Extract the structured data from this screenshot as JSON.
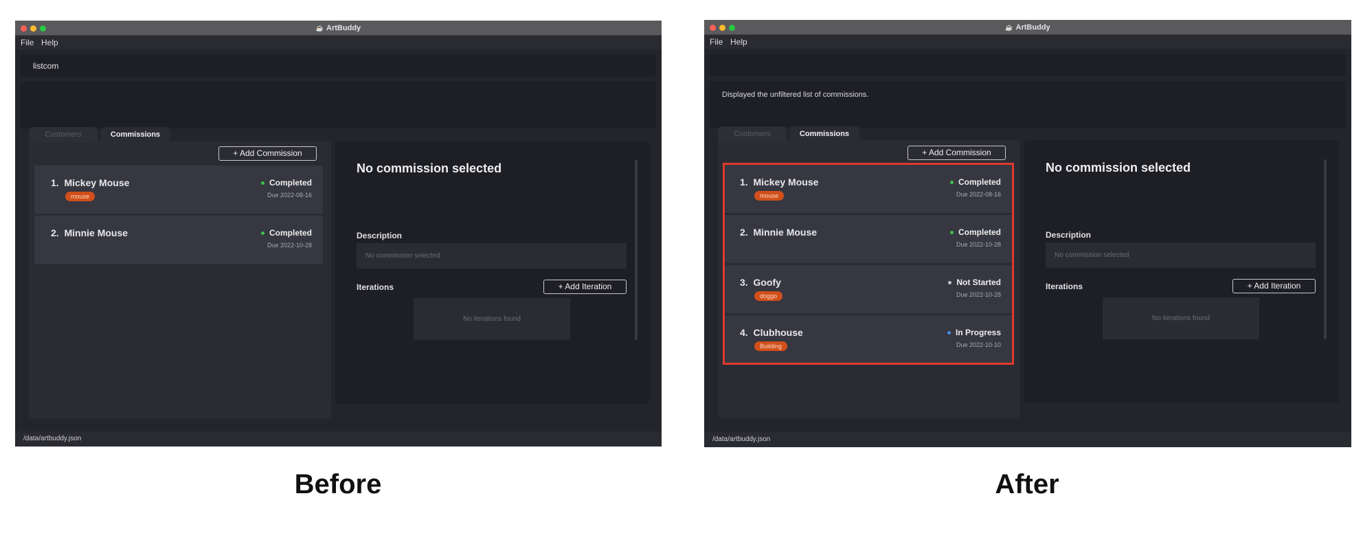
{
  "colors": {
    "completed": "#3fbf4f",
    "not_started": "#c4c4c8",
    "in_progress": "#4a86e8",
    "tag": "#d14f1b",
    "highlight": "#e0392d"
  },
  "before": {
    "window_title": "ArtBuddy",
    "menu": {
      "file": "File",
      "help": "Help"
    },
    "command_input": "listcom",
    "result_text": "",
    "tabs": {
      "customers": "Customers",
      "commissions": "Commissions"
    },
    "add_commission": "+   Add Commission",
    "commissions": [
      {
        "index": "1.",
        "name": "Mickey Mouse",
        "tag": "mouse",
        "status": "Completed",
        "due": "Due 2022-08-16"
      },
      {
        "index": "2.",
        "name": "Minnie Mouse",
        "tag": "",
        "status": "Completed",
        "due": "Due 2022-10-28"
      }
    ],
    "detail": {
      "title": "No commission selected",
      "description_label": "Description",
      "description_text": "No commission selected",
      "iterations_label": "Iterations",
      "add_iteration": "+   Add Iteration",
      "iterations_empty": "No iterations found"
    },
    "status_path": "/data/artbuddy.json",
    "caption": "Before"
  },
  "after": {
    "window_title": "ArtBuddy",
    "menu": {
      "file": "File",
      "help": "Help"
    },
    "command_input": "",
    "result_text": "Displayed the unfiltered list of commissions.",
    "tabs": {
      "customers": "Customers",
      "commissions": "Commissions"
    },
    "add_commission": "+   Add Commission",
    "commissions": [
      {
        "index": "1.",
        "name": "Mickey Mouse",
        "tag": "mouse",
        "status": "Completed",
        "due": "Due 2022-08-16"
      },
      {
        "index": "2.",
        "name": "Minnie Mouse",
        "tag": "",
        "status": "Completed",
        "due": "Due 2022-10-28"
      },
      {
        "index": "3.",
        "name": "Goofy",
        "tag": "doggo",
        "status": "Not Started",
        "due": "Due 2022-10-28"
      },
      {
        "index": "4.",
        "name": "Clubhouse",
        "tag": "Building",
        "status": "In Progress",
        "due": "Due 2022-10-10"
      }
    ],
    "detail": {
      "title": "No commission selected",
      "description_label": "Description",
      "description_text": "No commission selected",
      "iterations_label": "Iterations",
      "add_iteration": "+   Add Iteration",
      "iterations_empty": "No iterations found"
    },
    "status_path": "/data/artbuddy.json",
    "caption": "After"
  }
}
